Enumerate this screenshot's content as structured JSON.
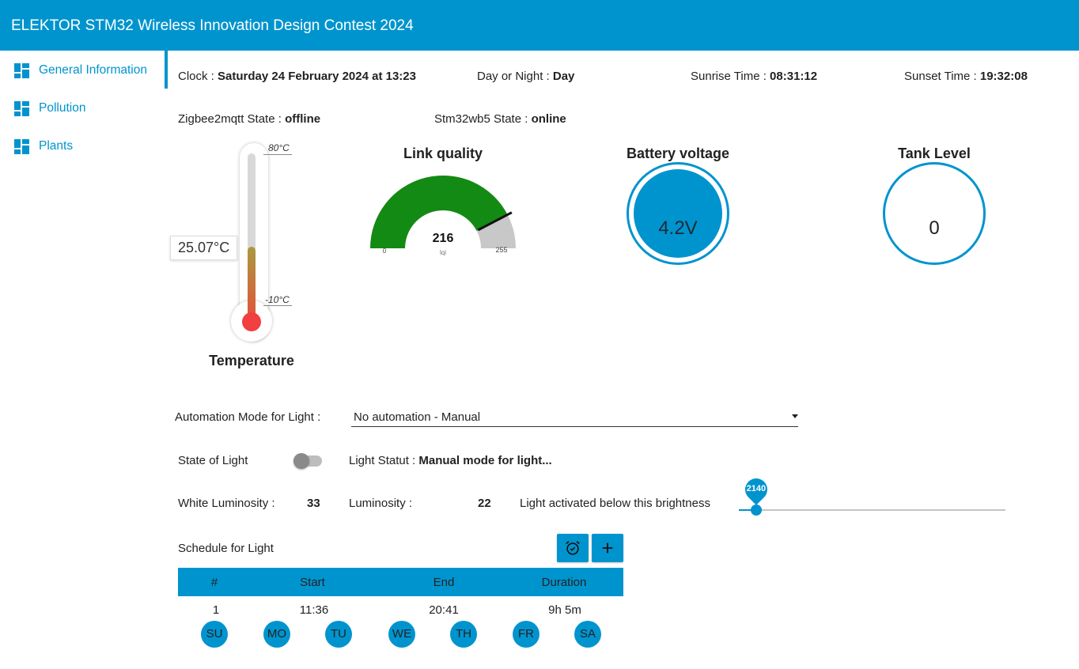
{
  "header": {
    "title": "ELEKTOR STM32 Wireless Innovation Design Contest 2024"
  },
  "sidebar": {
    "items": [
      {
        "label": "General Information",
        "active": true
      },
      {
        "label": "Pollution",
        "active": false
      },
      {
        "label": "Plants",
        "active": false
      }
    ]
  },
  "status": {
    "clock_label": "Clock : ",
    "clock_value": "Saturday 24 February 2024 at 13:23",
    "daynight_label": "Day or Night : ",
    "daynight_value": "Day",
    "sunrise_label": "Sunrise Time : ",
    "sunrise_value": "08:31:12",
    "sunset_label": "Sunset Time : ",
    "sunset_value": "19:32:08",
    "zigbee_label": "Zigbee2mqtt State : ",
    "zigbee_value": "offline",
    "stm_label": "Stm32wb5 State : ",
    "stm_value": "online"
  },
  "temperature": {
    "title": "Temperature",
    "max_label": "80°C",
    "min_label": "-10°C",
    "readout": "25.07°C",
    "value": 25.07,
    "min": -10,
    "max": 80
  },
  "link_quality": {
    "title": "Link quality",
    "value": 216,
    "value_text": "216",
    "min": 0,
    "max": 255,
    "min_label": "0",
    "max_label": "255",
    "unit": "lqi"
  },
  "battery": {
    "title": "Battery voltage",
    "value": "4.2V"
  },
  "tank": {
    "title": "Tank Level",
    "value": "0"
  },
  "automation": {
    "label": "Automation Mode for Light :",
    "selected": "No automation - Manual"
  },
  "light": {
    "state_label": "State of Light",
    "state_on": false,
    "statut_label": "Light Statut : ",
    "statut_value": "Manual mode for light...",
    "white_lum_label": "White Luminosity :",
    "white_lum_value": "33",
    "lum_label": "Luminosity :",
    "lum_value": "22",
    "threshold_label": "Light activated below this brightness",
    "threshold_value": 2140,
    "threshold_text": "2140",
    "threshold_fraction": 0.065
  },
  "schedule": {
    "title": "Schedule for Light",
    "alarm_icon": "alarm-clock-icon",
    "add_icon": "plus-icon",
    "columns": [
      "#",
      "Start",
      "End",
      "Duration"
    ],
    "rows": [
      {
        "num": "1",
        "start": "11:36",
        "end": "20:41",
        "duration": "9h 5m",
        "days": [
          "SU",
          "MO",
          "TU",
          "WE",
          "TH",
          "FR",
          "SA"
        ]
      }
    ]
  },
  "colors": {
    "accent": "#0094ce",
    "gauge_fill": "#138a13",
    "gauge_bg": "#c8c8c8",
    "thermo_hot": "#f23f3f"
  }
}
